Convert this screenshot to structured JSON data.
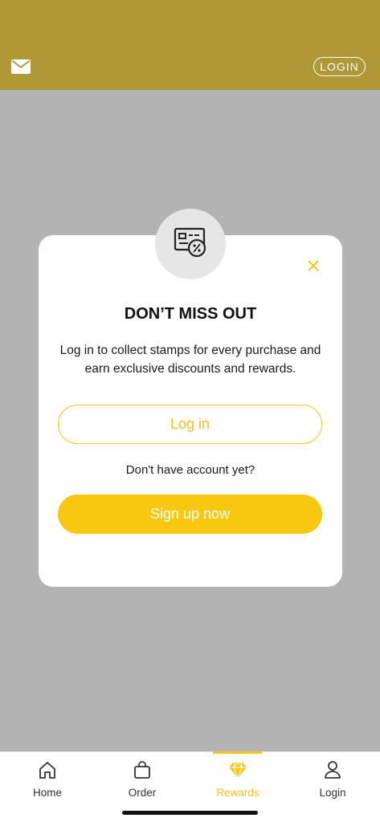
{
  "header": {
    "mail_icon": "mail-icon",
    "login_label": "LOGIN",
    "background": "#b09836"
  },
  "modal": {
    "icon": "discount-card-icon",
    "title": "DON’T MISS OUT",
    "description": "Log in to collect stamps for every purchase and earn exclusive discounts and rewards.",
    "login_button": "Log in",
    "no_account_text": "Don't have account yet?",
    "signup_button": "Sign up now",
    "accent_color": "#f8c811"
  },
  "tabbar": {
    "items": [
      {
        "label": "Home",
        "icon": "home-icon"
      },
      {
        "label": "Order",
        "icon": "bag-icon"
      },
      {
        "label": "Rewards",
        "icon": "diamond-icon",
        "active": true
      },
      {
        "label": "Login",
        "icon": "person-icon"
      }
    ]
  }
}
